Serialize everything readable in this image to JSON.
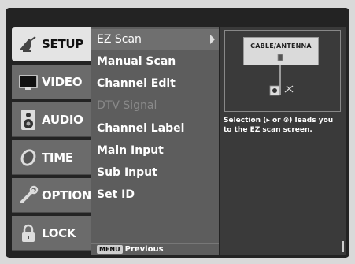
{
  "tabs": [
    {
      "label": "SETUP",
      "icon": "satellite-dish-icon",
      "active": true
    },
    {
      "label": "VIDEO",
      "icon": "monitor-icon",
      "active": false
    },
    {
      "label": "AUDIO",
      "icon": "speaker-icon",
      "active": false
    },
    {
      "label": "TIME",
      "icon": "clock-icon",
      "active": false
    },
    {
      "label": "OPTION",
      "icon": "wrench-icon",
      "active": false
    },
    {
      "label": "LOCK",
      "icon": "padlock-icon",
      "active": false
    }
  ],
  "menu": {
    "items": [
      {
        "label": "EZ Scan",
        "state": "selected"
      },
      {
        "label": "Manual Scan",
        "state": "normal"
      },
      {
        "label": "Channel Edit",
        "state": "normal"
      },
      {
        "label": "DTV Signal",
        "state": "disabled"
      },
      {
        "label": "Channel Label",
        "state": "normal"
      },
      {
        "label": "Main Input",
        "state": "normal"
      },
      {
        "label": "Sub Input",
        "state": "normal"
      },
      {
        "label": "Set ID",
        "state": "normal"
      }
    ],
    "footer_key": "MENU",
    "footer_label": "Previous"
  },
  "info": {
    "diagram_label": "CABLE/ANTENNA",
    "description_line1": "Selection (▸ or ⊙) leads you",
    "description_line2": "to the EZ scan screen."
  },
  "colors": {
    "background": "#d9d9d9",
    "osd": "#232323",
    "tab_inactive": "#6b6b6b",
    "tab_active": "#e4e4e4",
    "menu": "#5d5d5d",
    "info_panel": "#3a3a3a"
  }
}
